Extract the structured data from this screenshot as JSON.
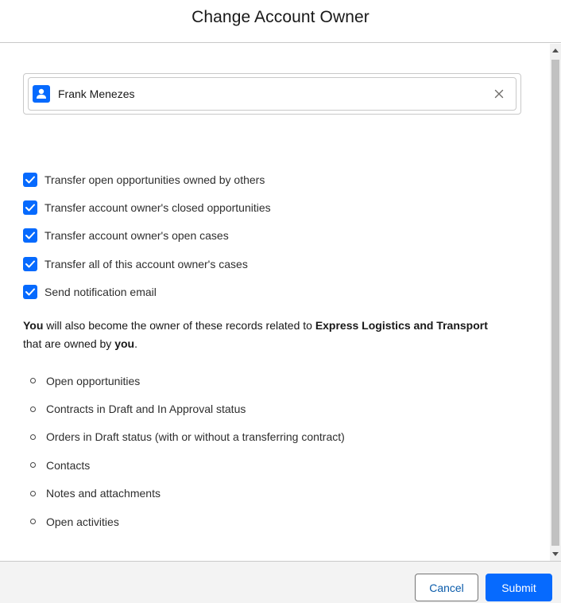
{
  "modal": {
    "title": "Change Account Owner"
  },
  "owner_lookup": {
    "selected_user": "Frank Menezes",
    "icon": "user-icon",
    "remove_icon": "close-icon"
  },
  "options": [
    {
      "label": "Transfer open opportunities owned by others",
      "checked": true
    },
    {
      "label": "Transfer account owner's closed opportunities",
      "checked": true
    },
    {
      "label": "Transfer account owner's open cases",
      "checked": true
    },
    {
      "label": "Transfer all of this account owner's cases",
      "checked": true
    },
    {
      "label": "Send notification email",
      "checked": true
    }
  ],
  "notice": {
    "you_1": "You",
    "middle": " will also become the owner of these records related to ",
    "account": "Express Logistics and Transport",
    "line2": "that are owned by ",
    "you_2": "you",
    "end": "."
  },
  "records": [
    "Open opportunities",
    "Contracts in Draft and In Approval status",
    "Orders in Draft status (with or without a transferring contract)",
    "Contacts",
    "Notes and attachments",
    "Open activities"
  ],
  "footer": {
    "cancel_label": "Cancel",
    "submit_label": "Submit"
  },
  "colors": {
    "brand": "#066afe",
    "cancel_text": "#0b5cab"
  }
}
